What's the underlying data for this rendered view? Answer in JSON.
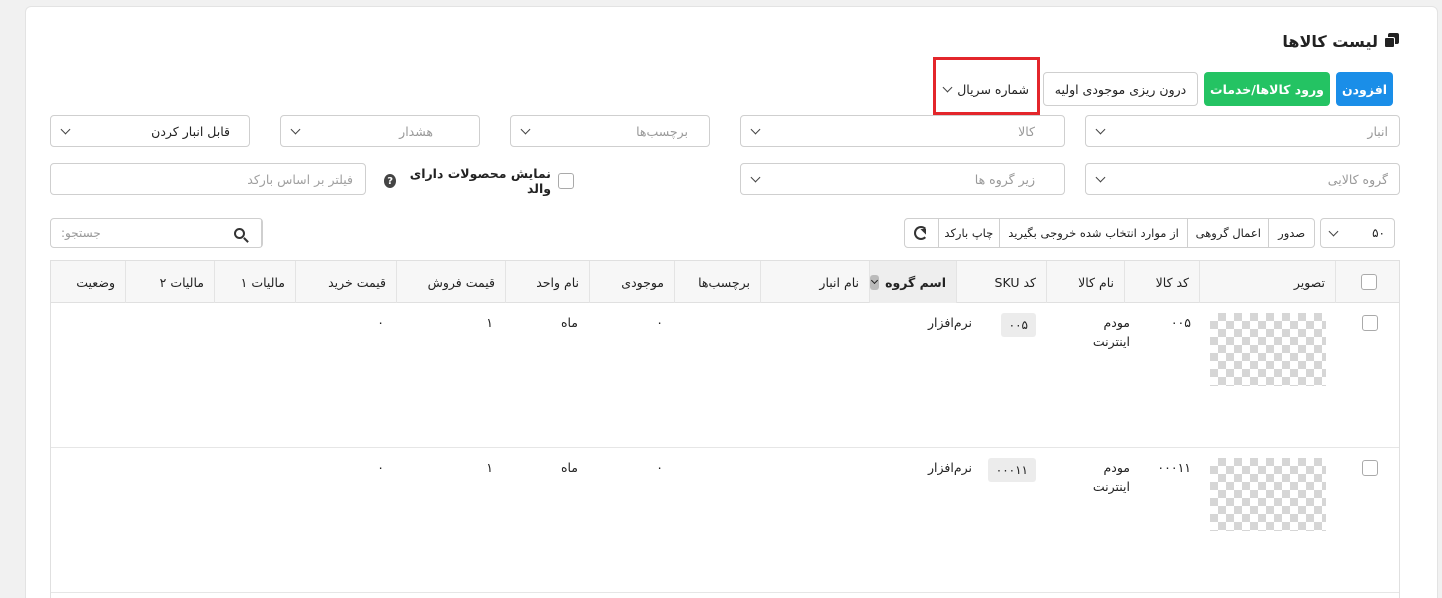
{
  "page": {
    "title": "لیست کالاها"
  },
  "toolbar": {
    "add_label": "افزودن",
    "import_label": "ورود کالاها/خدمات",
    "initial_stock_label": "درون ریزی موجودی اولیه",
    "serial_select_value": "شماره سریال"
  },
  "filters": {
    "warehouse_placeholder": "انبار",
    "product_placeholder": "کالا",
    "tags_placeholder": "برچسب‌ها",
    "warning_placeholder": "هشدار",
    "storable_value": "قابل انبار کردن",
    "product_group_placeholder": "گروه کالایی",
    "subgroup_placeholder": "زیر گروه ها",
    "show_parent_label": "نمایش محصولات دارای والد",
    "barcode_filter_placeholder": "فیلتر بر اساس بارکد"
  },
  "actions": {
    "per_page": "۵۰",
    "export": "صدور",
    "bulk_apply": "اعمال گروهی",
    "export_selected": "از موارد انتخاب شده خروجی بگیرید",
    "print_barcode": "چاپ بارکد",
    "search_placeholder": "جستجو:"
  },
  "table": {
    "headers": {
      "image": "تصویر",
      "code": "کد کالا",
      "name": "نام کالا",
      "sku": "کد SKU",
      "group": "اسم گروه",
      "warehouse": "نام انبار",
      "tags": "برچسب‌ها",
      "stock": "موجودی",
      "unit": "نام واحد",
      "sale_price": "قیمت فروش",
      "buy_price": "قیمت خرید",
      "tax1": "مالیات ۱",
      "tax2": "مالیات ۲",
      "status": "وضعیت"
    },
    "rows": [
      {
        "code": "۰۰۵",
        "name": "مودم اینترنت",
        "sku": "۰۰۵",
        "group": "نرم‌افزار",
        "stock": "۰",
        "unit": "ماه",
        "sale_price": "۱",
        "buy_price": "۰"
      },
      {
        "code": "۰۰۰۱۱",
        "name": "مودم اینترنت",
        "sku": "۰۰۰۱۱",
        "group": "نرم‌افزار",
        "stock": "۰",
        "unit": "ماه",
        "sale_price": "۱",
        "buy_price": "۰"
      }
    ]
  }
}
